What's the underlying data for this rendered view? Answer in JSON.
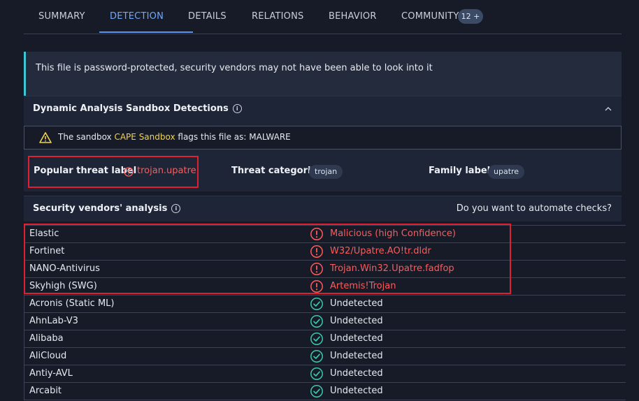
{
  "tabs": [
    {
      "label": "SUMMARY",
      "active": false
    },
    {
      "label": "DETECTION",
      "active": true
    },
    {
      "label": "DETAILS",
      "active": false
    },
    {
      "label": "RELATIONS",
      "active": false
    },
    {
      "label": "BEHAVIOR",
      "active": false
    },
    {
      "label": "COMMUNITY",
      "active": false
    }
  ],
  "community_badge": "12 +",
  "banner": {
    "text": "This file is password-protected, security vendors may not have been able to look into it"
  },
  "sandbox_section": {
    "title": "Dynamic Analysis Sandbox Detections",
    "prefix": "The sandbox ",
    "sandbox_name": "CAPE Sandbox",
    "suffix": " flags this file as: MALWARE"
  },
  "labels": {
    "popular_threat_label": "Popular threat label",
    "popular_threat_value": "trojan.upatre",
    "threat_categories": "Threat categories",
    "threat_categories_value": "trojan",
    "family_labels": "Family labels",
    "family_labels_value": "upatre"
  },
  "vendors_section": {
    "title": "Security vendors' analysis",
    "automate_text": "Do you want to automate checks?"
  },
  "vendors": [
    {
      "name": "Elastic",
      "result": "Malicious (high Confidence)",
      "status": "malicious"
    },
    {
      "name": "Fortinet",
      "result": "W32/Upatre.AO!tr.dldr",
      "status": "malicious"
    },
    {
      "name": "NANO-Antivirus",
      "result": "Trojan.Win32.Upatre.fadfop",
      "status": "malicious"
    },
    {
      "name": "Skyhigh (SWG)",
      "result": "Artemis!Trojan",
      "status": "malicious"
    },
    {
      "name": "Acronis (Static ML)",
      "result": "Undetected",
      "status": "clean"
    },
    {
      "name": "AhnLab-V3",
      "result": "Undetected",
      "status": "clean"
    },
    {
      "name": "Alibaba",
      "result": "Undetected",
      "status": "clean"
    },
    {
      "name": "AliCloud",
      "result": "Undetected",
      "status": "clean"
    },
    {
      "name": "Antiy-AVL",
      "result": "Undetected",
      "status": "clean"
    },
    {
      "name": "Arcabit",
      "result": "Undetected",
      "status": "clean"
    }
  ],
  "colors": {
    "accent": "#5b93f0",
    "malicious": "#ff5a5a",
    "clean": "#3cc7a8",
    "highlight": "#e02030",
    "sandbox_name": "#f3d24b"
  },
  "icons": {
    "warning": "warning-triangle-icon",
    "alert": "alert-circle-icon",
    "check": "check-circle-icon",
    "info": "info-icon",
    "collapse": "chevron-up-icon"
  }
}
